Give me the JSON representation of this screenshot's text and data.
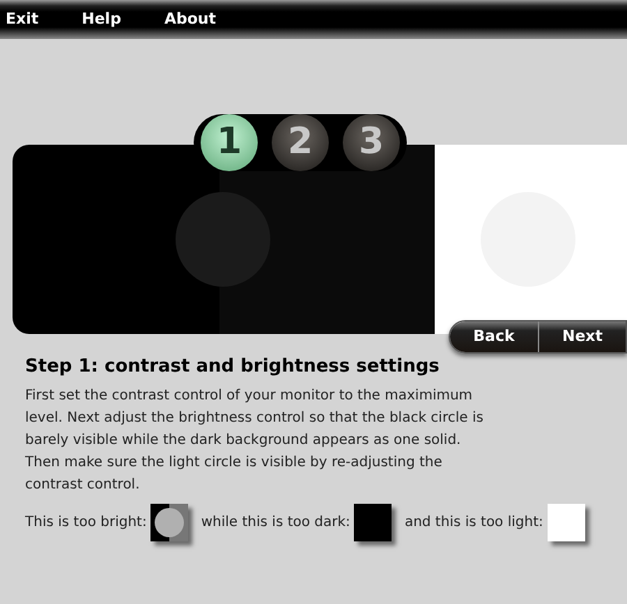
{
  "menu": [
    "Exit",
    "Help",
    "About"
  ],
  "steps": [
    {
      "label": "1",
      "selected": true
    },
    {
      "label": "2",
      "selected": false
    },
    {
      "label": "3",
      "selected": false
    }
  ],
  "buttons": [
    "Back",
    "Next"
  ],
  "heading": "Step 1: contrast and brightness settings",
  "paragraph": "First set the contrast control of your monitor to the maximimum level. Next adjust the brightness control so that the black circle is barely visible while the dark background appears as one solid. Then make sure the light circle is visible by re-adjusting the contrast control.",
  "examples": [
    {
      "label": "This is too bright:",
      "kind": "bright"
    },
    {
      "label": "while this is too dark:",
      "kind": "dark"
    },
    {
      "label": "and this is too light:",
      "kind": "light"
    }
  ]
}
